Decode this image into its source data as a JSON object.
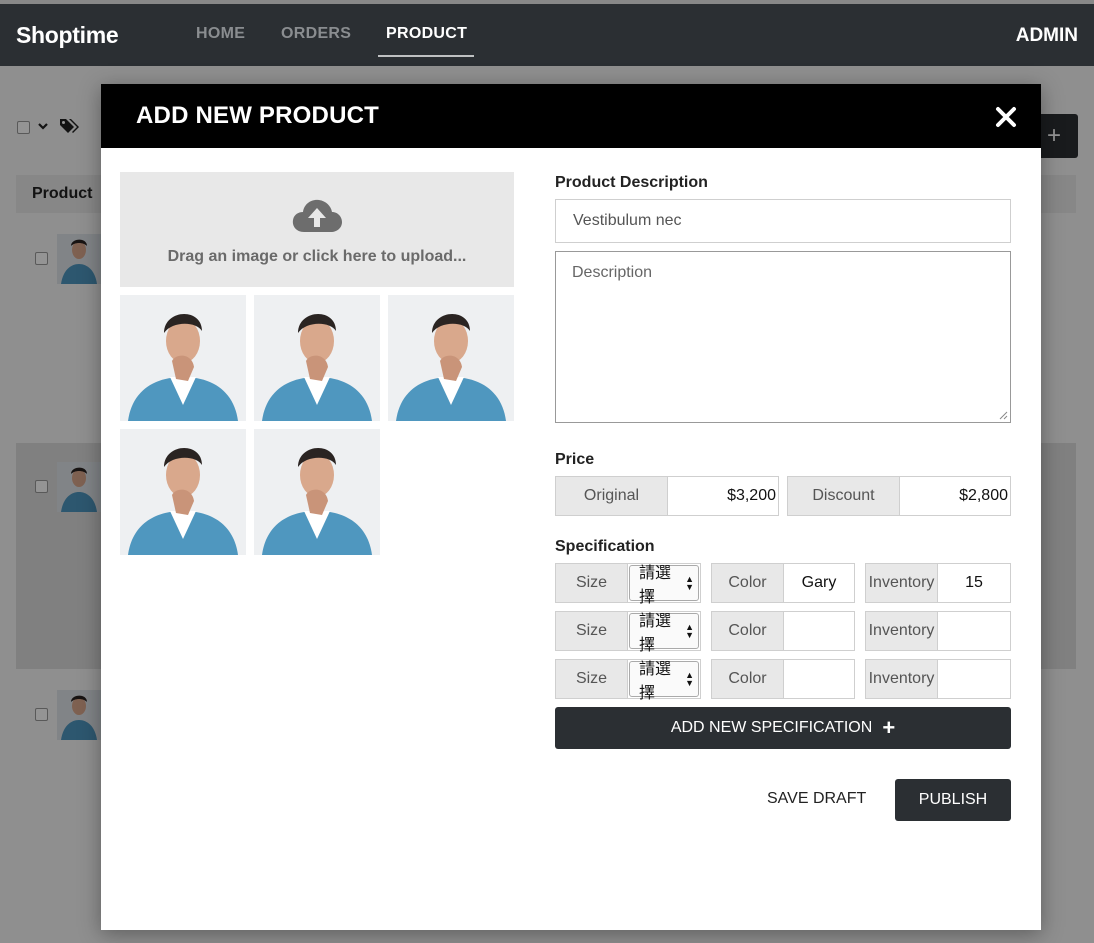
{
  "nav": {
    "brand": "Shoptime",
    "links": [
      "HOME",
      "ORDERS",
      "PRODUCT"
    ],
    "active": "PRODUCT",
    "user": "ADMIN"
  },
  "background": {
    "table_header": "Product",
    "add_button_icon": "plus-icon",
    "toolbar_icons": [
      "checkbox-icon",
      "chevron-down-icon",
      "tags-icon"
    ]
  },
  "modal": {
    "title": "ADD NEW PRODUCT",
    "close_icon": "close-icon",
    "upload": {
      "icon": "cloud-upload-icon",
      "text": "Drag an image or click here to upload..."
    },
    "photo_count": 5,
    "description": {
      "label": "Product Description",
      "name_value": "Vestibulum nec",
      "textarea_placeholder": "Description"
    },
    "price": {
      "label": "Price",
      "original_label": "Original",
      "original_value": "$3,200",
      "discount_label": "Discount",
      "discount_value": "$2,800"
    },
    "specification": {
      "label": "Specification",
      "rows": [
        {
          "size_label": "Size",
          "size_value": "請選擇",
          "color_label": "Color",
          "color_value": "Gary",
          "inventory_label": "Inventory",
          "inventory_value": "15"
        },
        {
          "size_label": "Size",
          "size_value": "請選擇",
          "color_label": "Color",
          "color_value": "",
          "inventory_label": "Inventory",
          "inventory_value": ""
        },
        {
          "size_label": "Size",
          "size_value": "請選擇",
          "color_label": "Color",
          "color_value": "",
          "inventory_label": "Inventory",
          "inventory_value": ""
        }
      ],
      "add_label": "ADD NEW SPECIFICATION"
    },
    "actions": {
      "save_draft": "SAVE DRAFT",
      "publish": "PUBLISH"
    }
  },
  "colors": {
    "dark": "#2b2f33",
    "header": "#000000",
    "addon_bg": "#e8e8e8"
  }
}
